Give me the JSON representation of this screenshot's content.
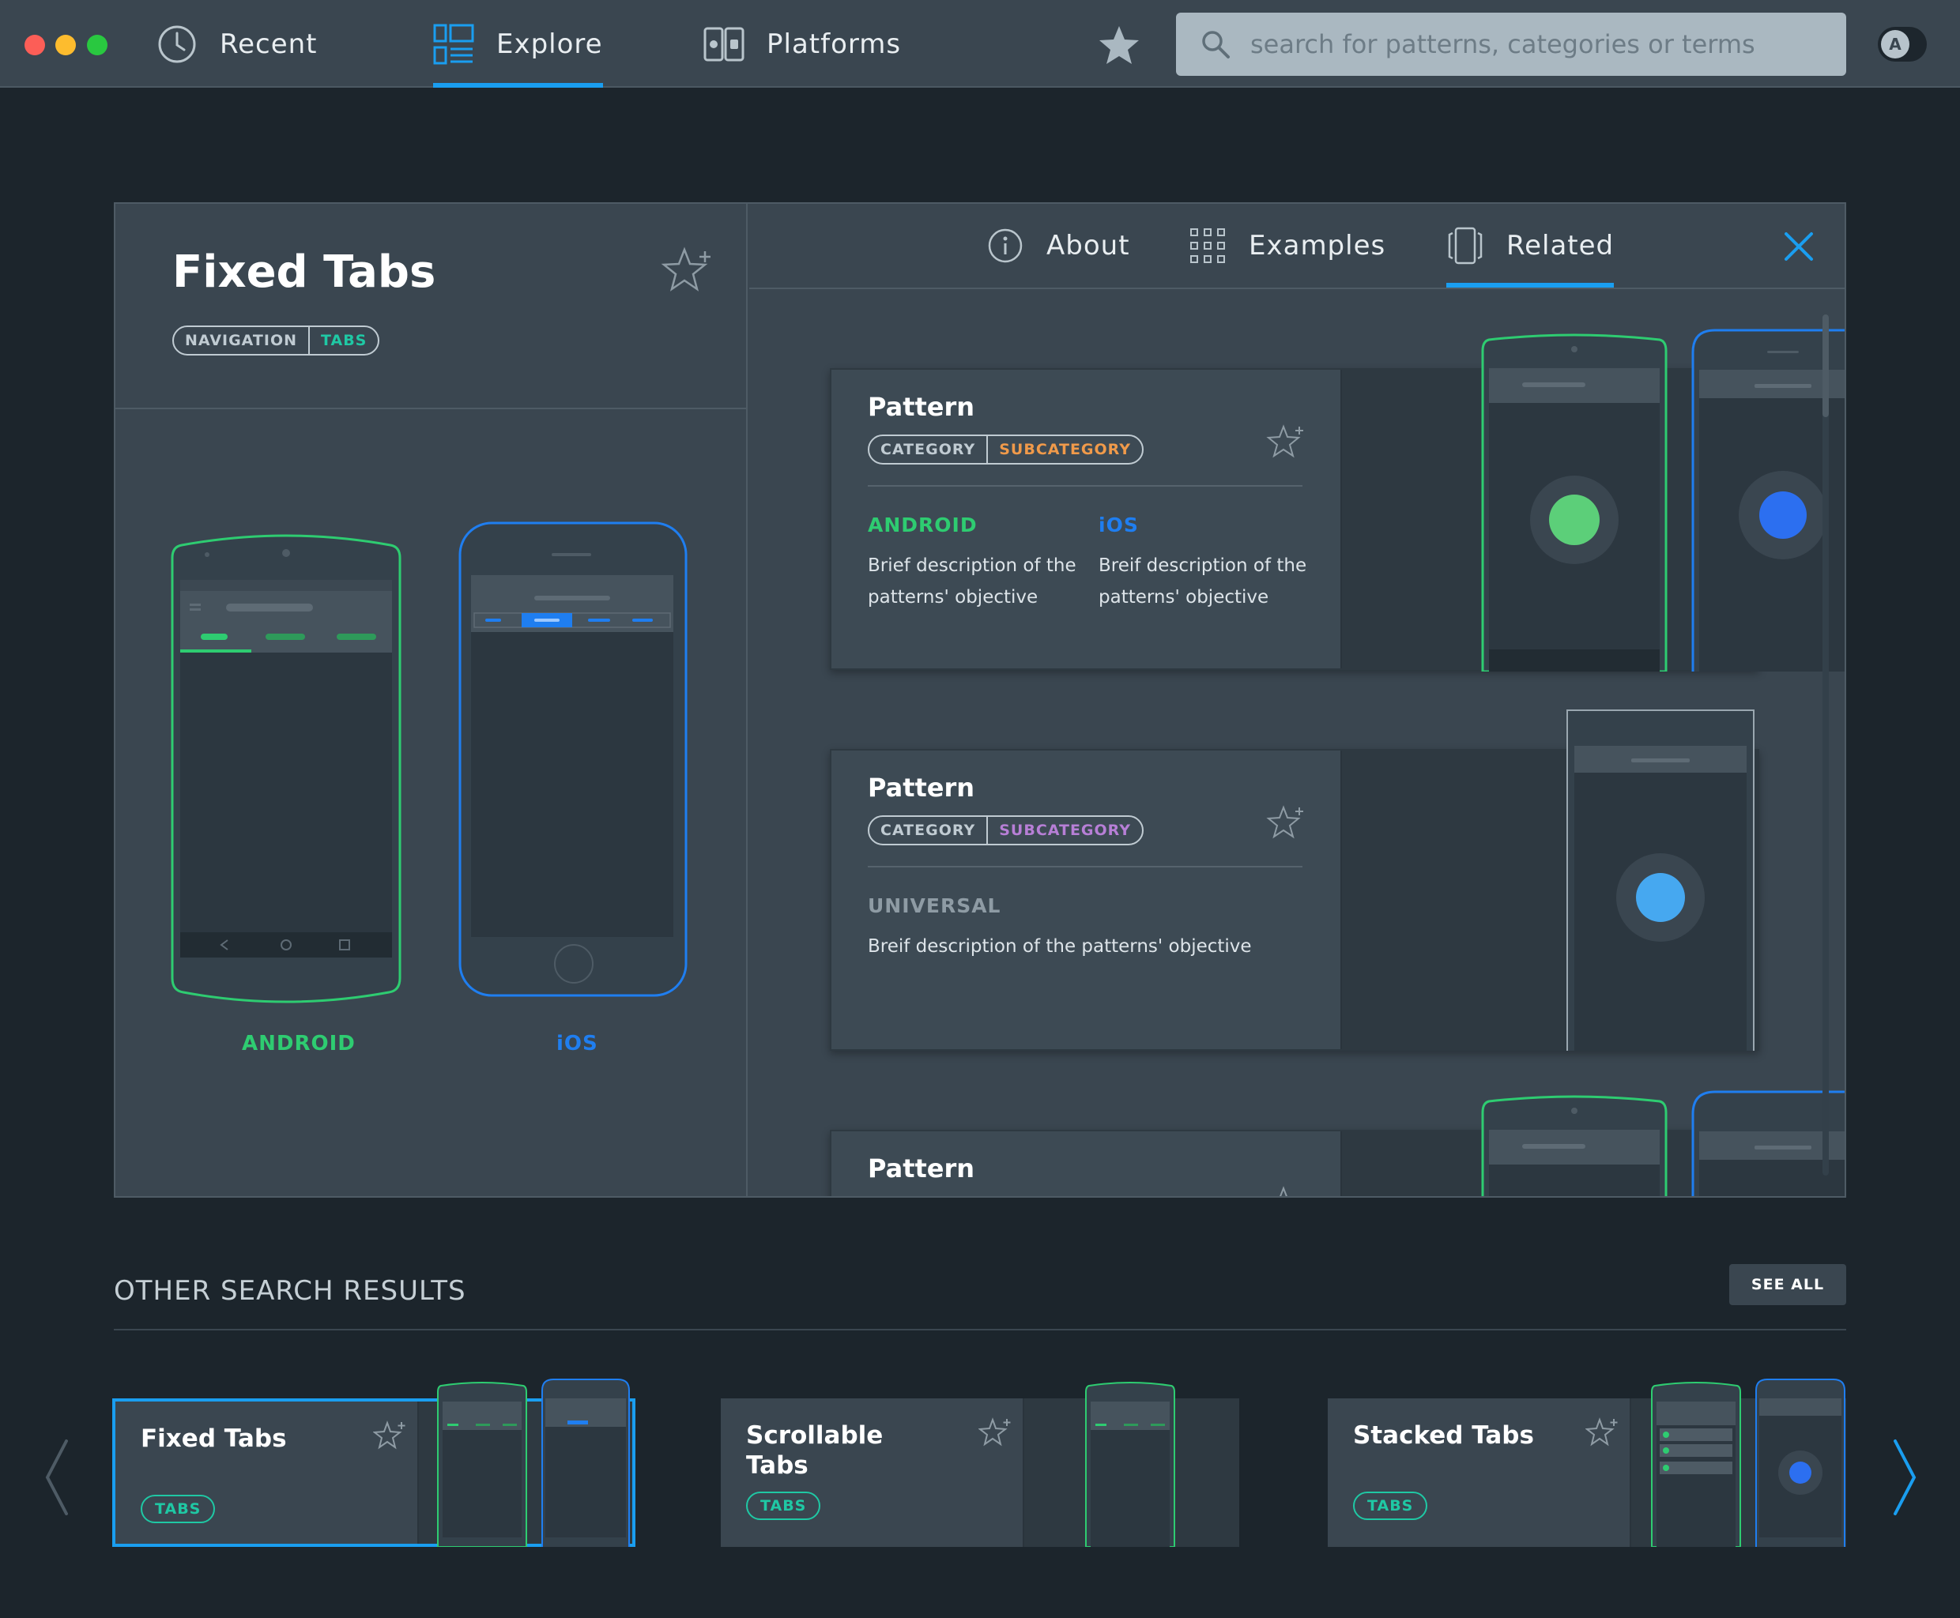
{
  "nav": {
    "recent": "Recent",
    "explore": "Explore",
    "platforms": "Platforms",
    "search_placeholder": "search for patterns, categories or terms",
    "profile_initial": "A"
  },
  "detail": {
    "title": "Fixed Tabs",
    "tag_category": "NAVIGATION",
    "tag_subcategory": "TABS",
    "android_label": "ANDROID",
    "ios_label": "iOS"
  },
  "tabs": {
    "about": "About",
    "examples": "Examples",
    "related": "Related"
  },
  "related_cards": [
    {
      "title": "Pattern",
      "category": "CATEGORY",
      "subcategory": "SUBCATEGORY",
      "subcategory_color": "#f09a4a",
      "android_label": "ANDROID",
      "android_desc": "Brief description of the patterns' objective",
      "ios_label": "iOS",
      "ios_desc": "Breif description of the patterns' objective"
    },
    {
      "title": "Pattern",
      "category": "CATEGORY",
      "subcategory": "SUBCATEGORY",
      "subcategory_color": "#b77fd6",
      "universal_label": "UNIVERSAL",
      "universal_desc": "Breif description of the patterns' objective"
    },
    {
      "title": "Pattern"
    }
  ],
  "other_results": {
    "title": "OTHER SEARCH RESULTS",
    "see_all": "SEE ALL",
    "items": [
      {
        "title": "Fixed Tabs",
        "tag": "TABS"
      },
      {
        "title": "Scrollable Tabs",
        "tag": "TABS"
      },
      {
        "title": "Stacked Tabs",
        "tag": "TABS"
      }
    ]
  },
  "colors": {
    "accent": "#1a9ef0",
    "android": "#2ecc71",
    "ios": "#1f7ef0",
    "tag_teal": "#1fc8a4"
  }
}
